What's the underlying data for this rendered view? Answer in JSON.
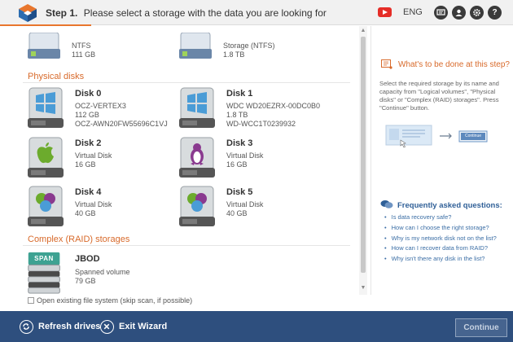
{
  "header": {
    "step_label": "Step 1.",
    "step_text": "Please select a storage with the data you are looking for",
    "language": "ENG"
  },
  "logical_volumes": [
    {
      "name": "",
      "line1": "NTFS",
      "line2": "111 GB"
    },
    {
      "name": "",
      "line1": "Storage (NTFS)",
      "line2": "1.8 TB"
    }
  ],
  "physical_section_title": "Physical disks",
  "physical_disks": [
    {
      "name": "Disk 0",
      "os": "windows",
      "lines": [
        "OCZ-VERTEX3",
        "112 GB",
        "OCZ-AWN20FW55696C1VJ"
      ]
    },
    {
      "name": "Disk 1",
      "os": "windows",
      "lines": [
        "WDC WD20EZRX-00DC0B0",
        "1.8 TB",
        "WD-WCC1T0239932"
      ]
    },
    {
      "name": "Disk 2",
      "os": "apple",
      "lines": [
        "Virtual Disk",
        "16 GB"
      ]
    },
    {
      "name": "Disk 3",
      "os": "linux",
      "lines": [
        "Virtual Disk",
        "16 GB"
      ]
    },
    {
      "name": "Disk 4",
      "os": "multi",
      "lines": [
        "Virtual Disk",
        "40 GB"
      ]
    },
    {
      "name": "Disk 5",
      "os": "multi",
      "lines": [
        "Virtual Disk",
        "40 GB"
      ]
    }
  ],
  "raid_section_title": "Complex (RAID) storages",
  "raid": [
    {
      "name": "JBOD",
      "badge": "SPAN",
      "lines": [
        "Spanned volume",
        "79 GB"
      ]
    }
  ],
  "options": {
    "open_fs_label": "Open existing file system (skip scan, if possible)"
  },
  "help": {
    "title": "What's to be done at this step?",
    "text": "Select the required storage by its name and capacity from \"Logical volumes\", \"Physical disks\" or \"Complex (RAID) storages\". Press \"Continue\" button.",
    "illus_button": "Continue"
  },
  "faq": {
    "title": "Frequently asked questions:",
    "items": [
      "Is data recovery safe?",
      "How can I choose the right storage?",
      "Why is my network disk not on the list?",
      "How can I recover data from RAID?",
      "Why isn't there any disk in the list?"
    ]
  },
  "footer": {
    "refresh_label": "Refresh drives",
    "exit_label": "Exit Wizard",
    "continue_label": "Continue"
  },
  "colors": {
    "accent": "#d86a2b",
    "footer": "#2e4f7e",
    "link": "#3b6ea5"
  }
}
